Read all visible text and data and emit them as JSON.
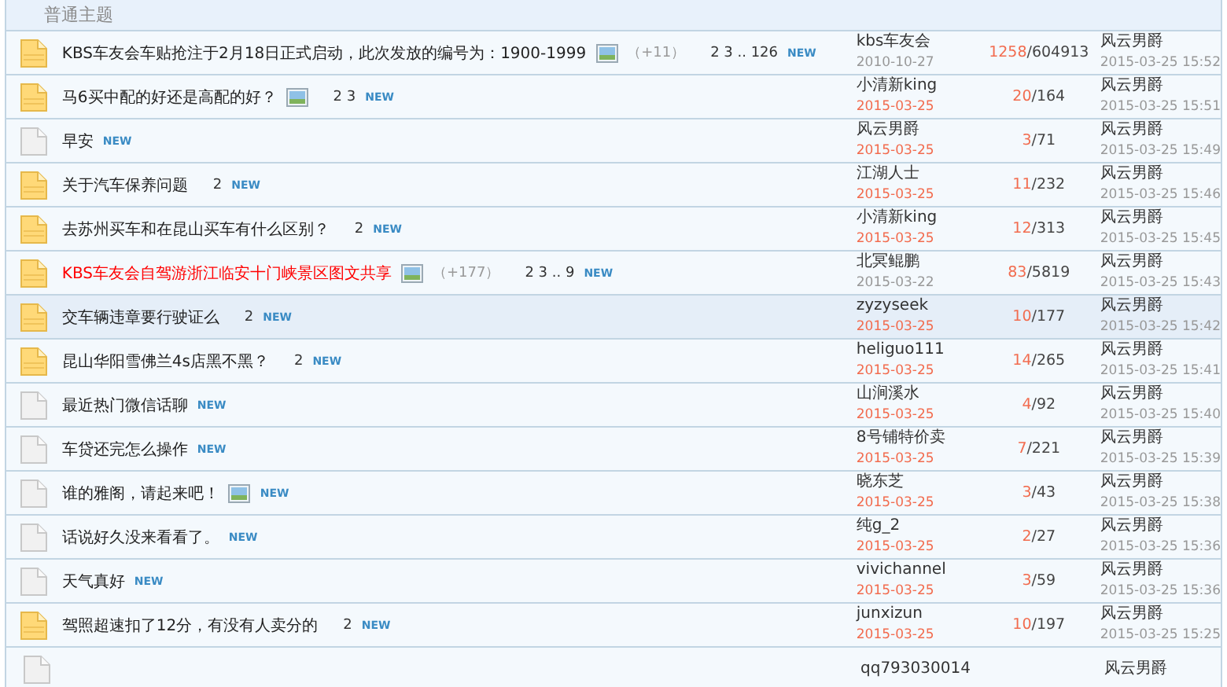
{
  "section": {
    "title": "普通主题"
  },
  "rows": [
    {
      "kind": "hot",
      "title": "KBS车友会车贴抢注于2月18日正式启动，此次发放的编号为：1900-1999",
      "highlighted": false,
      "has_image": true,
      "extra": "（+11）",
      "pages": "2 3 .. 126",
      "badge": "NEW",
      "author": "kbs车友会",
      "date": "2010-10-27",
      "date_recent": false,
      "replies": "1258",
      "views": "/604913",
      "last_poster": "风云男爵",
      "last_time": "2015-03-25 15:52",
      "selected": false
    },
    {
      "kind": "hot",
      "title": "马6买中配的好还是高配的好？",
      "highlighted": false,
      "has_image": true,
      "pages": "2 3",
      "badge": "NEW",
      "author": "小清新king",
      "date": "2015-03-25",
      "date_recent": true,
      "replies": "20",
      "views": "/164",
      "last_poster": "风云男爵",
      "last_time": "2015-03-25 15:51",
      "selected": false
    },
    {
      "kind": "plain",
      "title": "早安",
      "highlighted": false,
      "has_image": false,
      "badge": "NEW",
      "author": "风云男爵",
      "date": "2015-03-25",
      "date_recent": true,
      "replies": "3",
      "views": "/71",
      "last_poster": "风云男爵",
      "last_time": "2015-03-25 15:49",
      "selected": false
    },
    {
      "kind": "hot",
      "title": "关于汽车保养问题",
      "highlighted": false,
      "has_image": false,
      "pages": "2",
      "badge": "NEW",
      "author": "江湖人士",
      "date": "2015-03-25",
      "date_recent": true,
      "replies": "11",
      "views": "/232",
      "last_poster": "风云男爵",
      "last_time": "2015-03-25 15:46",
      "selected": false
    },
    {
      "kind": "hot",
      "title": "去苏州买车和在昆山买车有什么区别？",
      "highlighted": false,
      "has_image": false,
      "pages": "2",
      "badge": "NEW",
      "author": "小清新king",
      "date": "2015-03-25",
      "date_recent": true,
      "replies": "12",
      "views": "/313",
      "last_poster": "风云男爵",
      "last_time": "2015-03-25 15:45",
      "selected": false
    },
    {
      "kind": "hot",
      "title": "KBS车友会自驾游浙江临安十门峡景区图文共享",
      "highlighted": true,
      "has_image": true,
      "extra": "（+177）",
      "pages": "2 3 .. 9",
      "badge": "NEW",
      "author": "北冥鲲鹏",
      "date": "2015-03-22",
      "date_recent": false,
      "replies": "83",
      "views": "/5819",
      "last_poster": "风云男爵",
      "last_time": "2015-03-25 15:43",
      "selected": false
    },
    {
      "kind": "hot",
      "title": "交车辆违章要行驶证么",
      "highlighted": false,
      "has_image": false,
      "pages": "2",
      "badge": "NEW",
      "author": "zyzyseek",
      "date": "2015-03-25",
      "date_recent": true,
      "replies": "10",
      "views": "/177",
      "last_poster": "风云男爵",
      "last_time": "2015-03-25 15:42",
      "selected": true
    },
    {
      "kind": "hot",
      "title": "昆山华阳雪佛兰4s店黑不黑？",
      "highlighted": false,
      "has_image": false,
      "pages": "2",
      "badge": "NEW",
      "author": "heliguo111",
      "date": "2015-03-25",
      "date_recent": true,
      "replies": "14",
      "views": "/265",
      "last_poster": "风云男爵",
      "last_time": "2015-03-25 15:41",
      "selected": false
    },
    {
      "kind": "plain",
      "title": "最近热门微信话聊",
      "highlighted": false,
      "has_image": false,
      "badge": "NEW",
      "author": "山涧溪水",
      "date": "2015-03-25",
      "date_recent": true,
      "replies": "4",
      "views": "/92",
      "last_poster": "风云男爵",
      "last_time": "2015-03-25 15:40",
      "selected": false
    },
    {
      "kind": "plain",
      "title": "车贷还完怎么操作",
      "highlighted": false,
      "has_image": false,
      "badge": "NEW",
      "author": "8号铺特价卖",
      "date": "2015-03-25",
      "date_recent": true,
      "replies": "7",
      "views": "/221",
      "last_poster": "风云男爵",
      "last_time": "2015-03-25 15:39",
      "selected": false
    },
    {
      "kind": "plain",
      "title": "谁的雅阁，请起来吧！",
      "highlighted": false,
      "has_image": true,
      "badge": "NEW",
      "author": "晓东芝",
      "date": "2015-03-25",
      "date_recent": true,
      "replies": "3",
      "views": "/43",
      "last_poster": "风云男爵",
      "last_time": "2015-03-25 15:38",
      "selected": false
    },
    {
      "kind": "plain",
      "title": "话说好久没来看看了。",
      "highlighted": false,
      "has_image": false,
      "badge": "NEW",
      "author": "纯g_2",
      "date": "2015-03-25",
      "date_recent": true,
      "replies": "2",
      "views": "/27",
      "last_poster": "风云男爵",
      "last_time": "2015-03-25 15:36",
      "selected": false
    },
    {
      "kind": "plain",
      "title": "天气真好",
      "highlighted": false,
      "has_image": false,
      "badge": "NEW",
      "author": "vivichannel",
      "date": "2015-03-25",
      "date_recent": true,
      "replies": "3",
      "views": "/59",
      "last_poster": "风云男爵",
      "last_time": "2015-03-25 15:36",
      "selected": false
    },
    {
      "kind": "hot",
      "title": "驾照超速扣了12分，有没有人卖分的",
      "highlighted": false,
      "has_image": false,
      "pages": "2",
      "badge": "NEW",
      "author": "junxizun",
      "date": "2015-03-25",
      "date_recent": true,
      "replies": "10",
      "views": "/197",
      "last_poster": "风云男爵",
      "last_time": "2015-03-25 15:25",
      "selected": false
    },
    {
      "kind": "plain",
      "author": "qq793030014",
      "last_poster": "风云男爵",
      "selected": false
    }
  ]
}
